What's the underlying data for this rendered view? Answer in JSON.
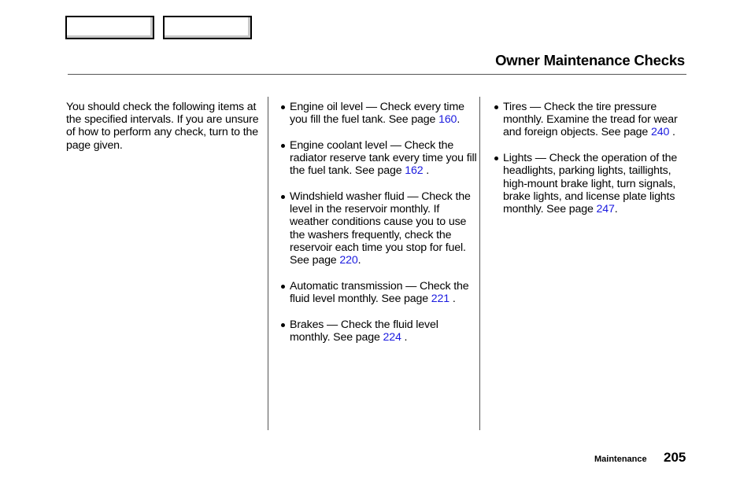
{
  "nav": {
    "buttons": [
      {
        "label": ""
      },
      {
        "label": ""
      }
    ]
  },
  "header": {
    "title": "Owner Maintenance Checks"
  },
  "intro": {
    "text": "You should check the following items at the specified intervals. If you are unsure of how to perform any check, turn to the page given."
  },
  "columns": [
    {
      "items": [
        {
          "text": "Engine oil level — Check every time you fill the fuel tank. See page ",
          "page": "160",
          "suffix": "."
        },
        {
          "text": "Engine coolant level — Check the radiator reserve tank every time you fill the fuel tank. See page ",
          "page": "162",
          "suffix": " ."
        },
        {
          "text": "Windshield washer fluid — Check the level in the reservoir monthly. If weather conditions cause you to use the washers frequently, check the reservoir each time you stop for fuel. See page ",
          "page": "220",
          "suffix": "."
        },
        {
          "text": "Automatic transmission — Check the fluid level monthly. See page ",
          "page": "221",
          "suffix": " ."
        },
        {
          "text": "Brakes — Check the fluid level monthly. See page ",
          "page": "224",
          "suffix": " ."
        }
      ]
    },
    {
      "items": [
        {
          "text": "Tires — Check the tire pressure monthly. Examine the tread for wear and foreign objects. See page ",
          "page": "240",
          "suffix": " ."
        },
        {
          "text": "Lights — Check the operation of the headlights, parking lights, taillights, high-mount brake light, turn signals, brake lights, and license plate lights monthly. See page ",
          "page": "247",
          "suffix": "."
        }
      ]
    }
  ],
  "footer": {
    "section": "Maintenance",
    "page_number": "205"
  },
  "colors": {
    "link": "#1a1adf",
    "text": "#000000",
    "rule": "#555555"
  }
}
